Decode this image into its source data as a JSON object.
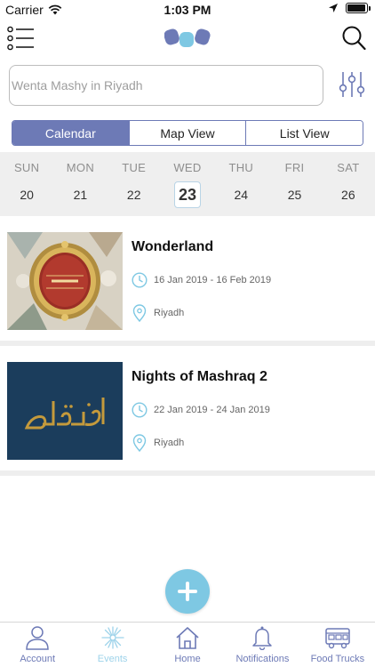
{
  "status_bar": {
    "carrier": "Carrier",
    "time": "1:03 PM",
    "battery_level": 0.95
  },
  "nav": {
    "menu_icon": "list-icon",
    "logo": "app-logo",
    "search_icon": "search-icon"
  },
  "search": {
    "placeholder": "Wenta Mashy in Riyadh",
    "value": ""
  },
  "view_tabs": [
    {
      "label": "Calendar",
      "active": true
    },
    {
      "label": "Map View",
      "active": false
    },
    {
      "label": "List View",
      "active": false
    }
  ],
  "week": [
    {
      "name": "SUN",
      "num": "20"
    },
    {
      "name": "MON",
      "num": "21"
    },
    {
      "name": "TUE",
      "num": "22"
    },
    {
      "name": "WED",
      "num": "23",
      "selected": true
    },
    {
      "name": "THU",
      "num": "24"
    },
    {
      "name": "FRI",
      "num": "25"
    },
    {
      "name": "SAT",
      "num": "26"
    }
  ],
  "events": [
    {
      "title": "Wonderland",
      "dates": "16 Jan 2019 - 16 Feb 2019",
      "location": "Riyadh",
      "image": "wonderland-poster"
    },
    {
      "title": "Nights of Mashraq 2",
      "dates": "22 Jan 2019 - 24 Jan 2019",
      "location": "Riyadh",
      "image": "mashraq-poster"
    }
  ],
  "fab": {
    "icon": "plus-icon"
  },
  "tabbar": [
    {
      "label": "Account",
      "icon": "account-icon",
      "active": false
    },
    {
      "label": "Events",
      "icon": "events-icon",
      "active": true
    },
    {
      "label": "Home",
      "icon": "home-icon",
      "active": false
    },
    {
      "label": "Notifications",
      "icon": "bell-icon",
      "active": false
    },
    {
      "label": "Food Trucks",
      "icon": "food-truck-icon",
      "active": false
    }
  ],
  "colors": {
    "accent": "#6d7ab6",
    "light_accent": "#7ec8e3",
    "strip_bg": "#efefef",
    "mashraq_bg": "#1b3d5c",
    "mashraq_gold": "#c49a3c"
  }
}
